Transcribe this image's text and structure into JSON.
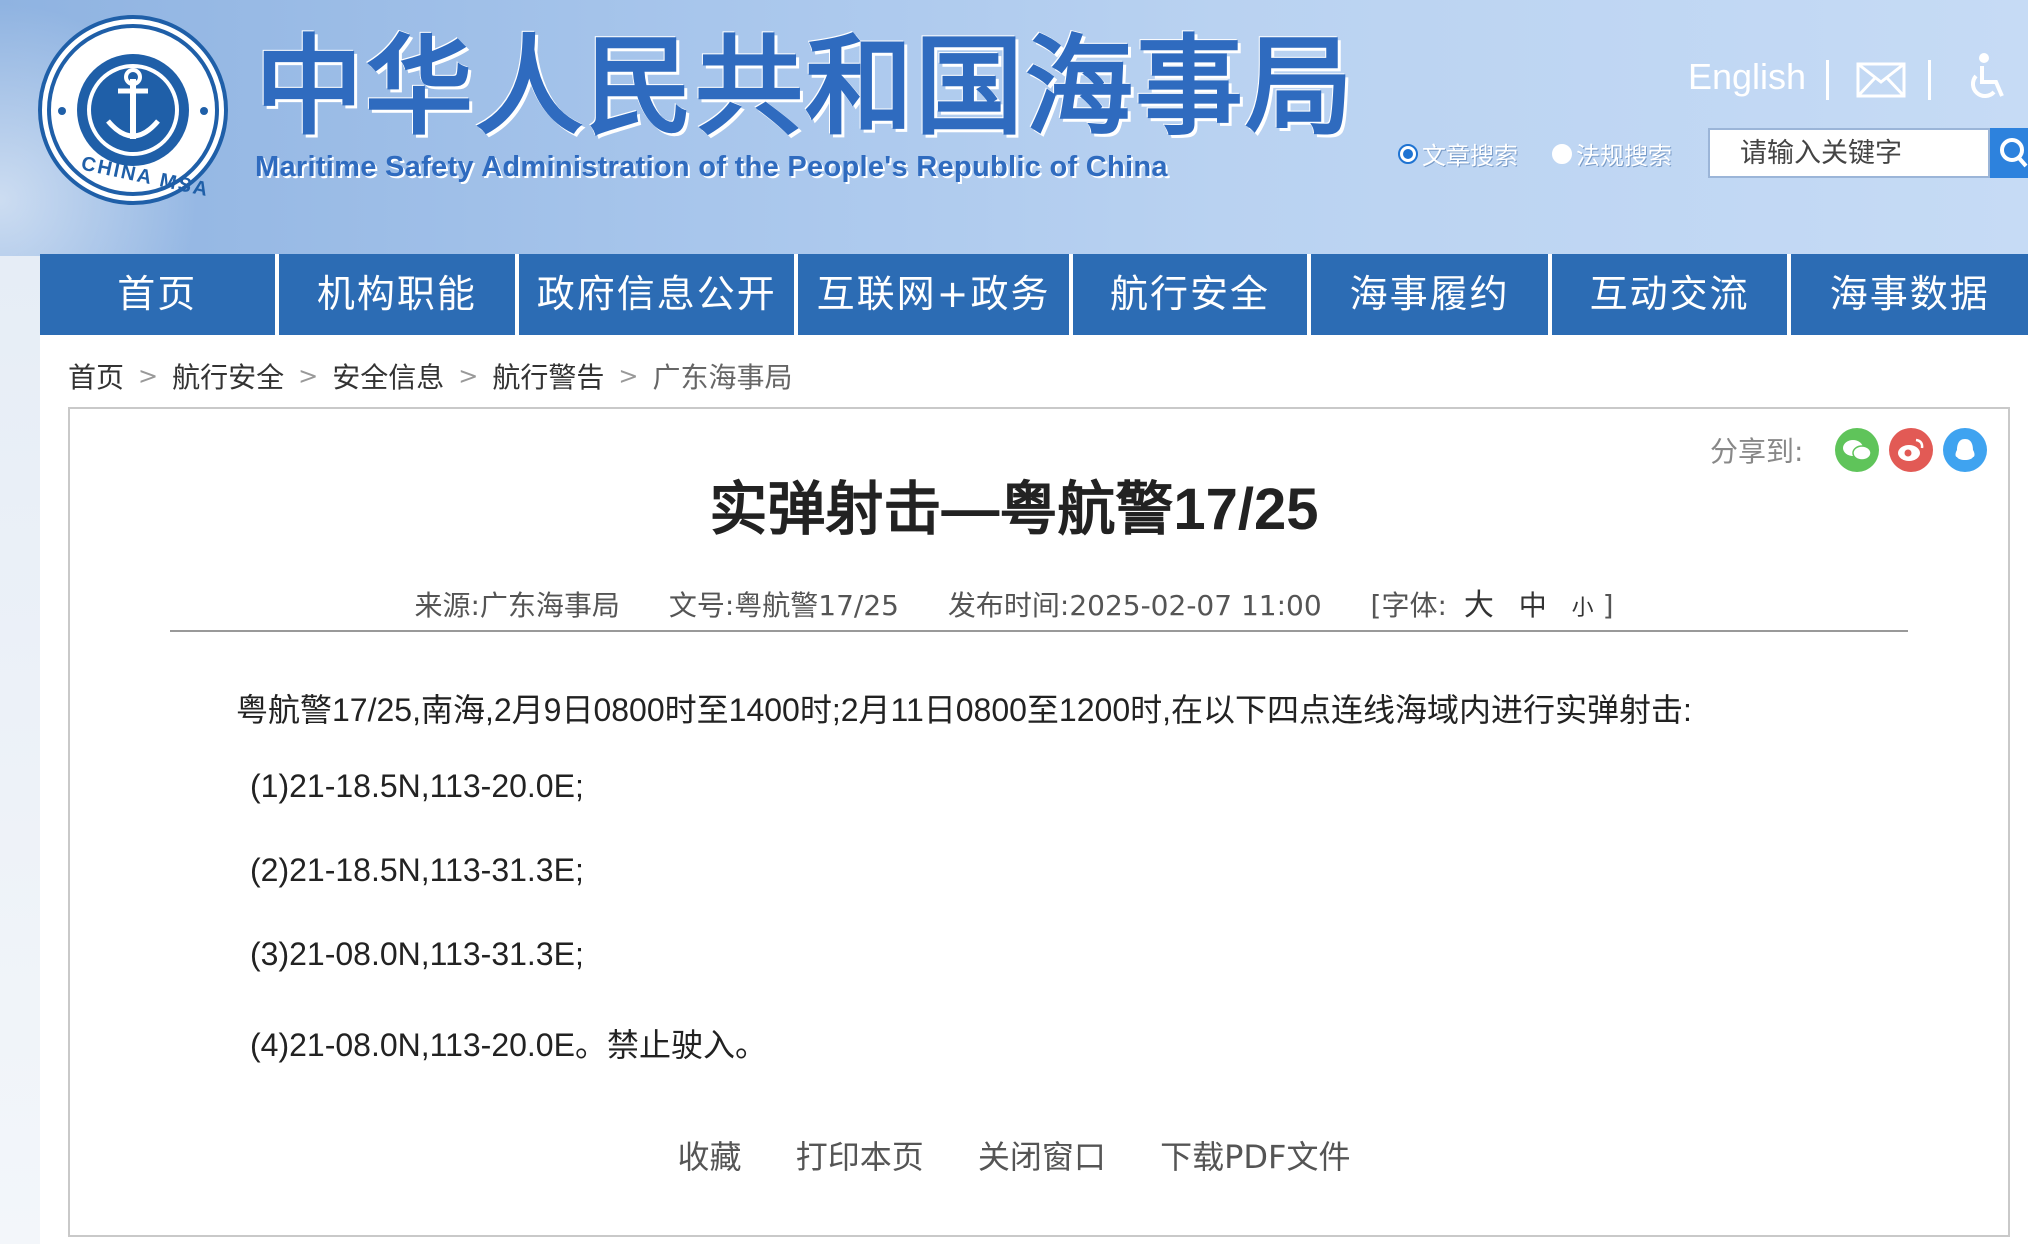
{
  "header": {
    "title_cn": "中华人民共和国海事局",
    "title_en": "Maritime Safety Administration of the People's Republic of China",
    "logo_text": "CHINA MSA",
    "english_link": "English",
    "search_options": [
      {
        "label": "文章搜索",
        "checked": true
      },
      {
        "label": "法规搜索",
        "checked": false
      }
    ],
    "search_placeholder": "请输入关键字"
  },
  "nav": {
    "items": [
      "首页",
      "机构职能",
      "政府信息公开",
      "互联网+政务",
      "航行安全",
      "海事履约",
      "互动交流",
      "海事数据"
    ]
  },
  "breadcrumb": [
    "首页",
    "航行安全",
    "安全信息",
    "航行警告",
    "广东海事局"
  ],
  "share": {
    "label": "分享到:"
  },
  "article": {
    "title": "实弹射击—粤航警17/25",
    "source": "来源:广东海事局",
    "doc_no": "文号:粤航警17/25",
    "published": "发布时间:2025-02-07 11:00",
    "font_label": "[字体:",
    "font_large": "大",
    "font_medium": "中",
    "font_small": "小",
    "font_close": "]",
    "intro": "粤航警17/25,南海,2月9日0800时至1400时;2月11日0800至1200时,在以下四点连线海域内进行实弹射击:",
    "points": [
      "(1)21-18.5N,113-20.0E;",
      "(2)21-18.5N,113-31.3E;",
      "(3)21-08.0N,113-31.3E;",
      "(4)21-08.0N,113-20.0E。禁止驶入。"
    ]
  },
  "actions": {
    "favorite": "收藏",
    "print": "打印本页",
    "close": "关闭窗口",
    "download": "下载PDF文件"
  }
}
